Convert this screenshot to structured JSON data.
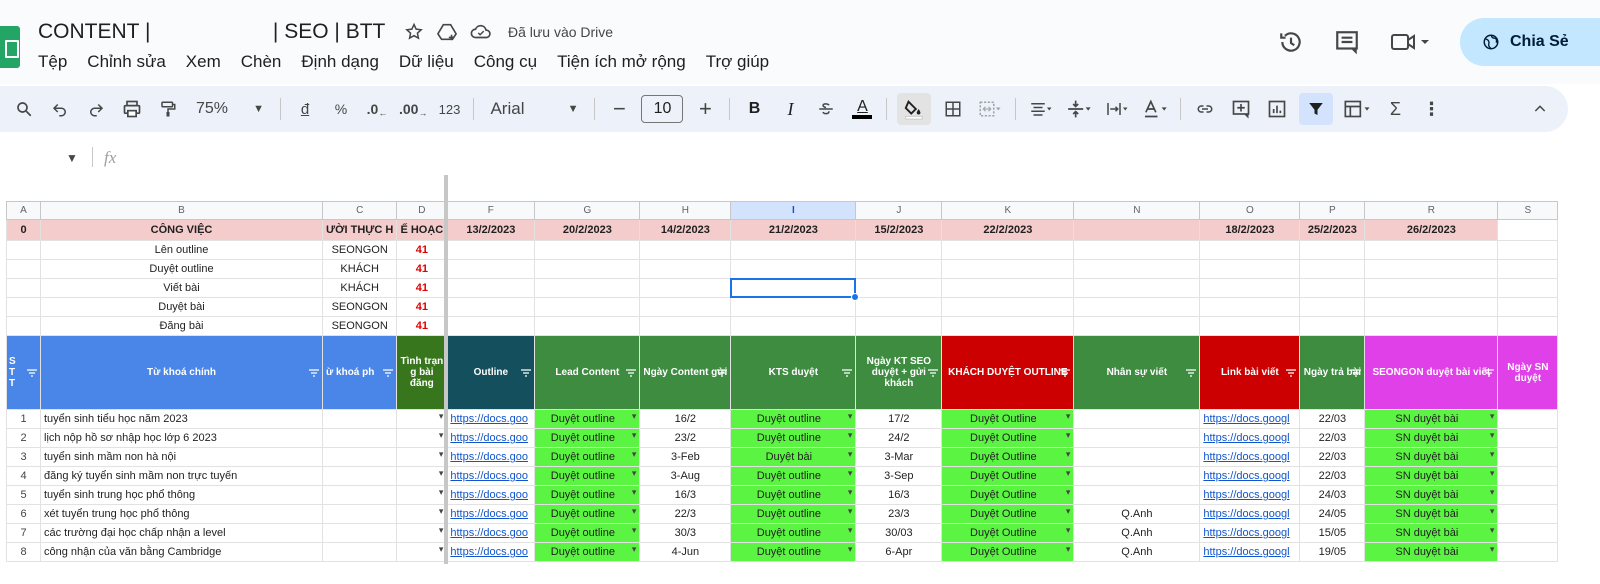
{
  "header": {
    "doc_title": "CONTENT |                     | SEO | BTT",
    "saved_status": "Đã lưu vào Drive",
    "share_label": "Chia Sẻ"
  },
  "menu": [
    "Tệp",
    "Chỉnh sửa",
    "Xem",
    "Chèn",
    "Định dạng",
    "Dữ liệu",
    "Công cụ",
    "Tiện ích mở rộng",
    "Trợ giúp"
  ],
  "toolbar": {
    "zoom": "75%",
    "currency": "đ",
    "percent": "%",
    "dec_decrease": ".0",
    "dec_increase": ".00",
    "number_format": "123",
    "font": "Arial",
    "font_size": "10",
    "bold": "B",
    "italic": "I",
    "text_color": "A"
  },
  "formula_bar": {
    "fx": "fx"
  },
  "columns": [
    "A",
    "B",
    "C",
    "D",
    "F",
    "G",
    "H",
    "I",
    "J",
    "K",
    "N",
    "O",
    "P",
    "R",
    "S"
  ],
  "summary_row": [
    "0",
    "CÔNG VIỆC",
    "ƯỜI THỰC H",
    "Ế HOẠC",
    "13/2/2023",
    "20/2/2023",
    "14/2/2023",
    "21/2/2023",
    "15/2/2023",
    "22/2/2023",
    "",
    "18/2/2023",
    "25/2/2023",
    "26/2/2023",
    ""
  ],
  "plan_rows": [
    {
      "task": "Lên outline",
      "owner": "SEONGON",
      "value": "41"
    },
    {
      "task": "Duyệt outline",
      "owner": "KHÁCH",
      "value": "41"
    },
    {
      "task": "Viết bài",
      "owner": "KHÁCH",
      "value": "41"
    },
    {
      "task": "Duyệt bài",
      "owner": "SEONGON",
      "value": "41"
    },
    {
      "task": "Đăng bài",
      "owner": "SEONGON",
      "value": "41"
    }
  ],
  "table_headers": {
    "stt": "S T T",
    "keyword": "Từ khoá chính",
    "sub_keyword": "ừ khoá ph",
    "status": "Tình trạn g bài đăng",
    "outline": "Outline",
    "lead": "Lead Content",
    "sent_date": "Ngày Content gửi",
    "kts": "KTS duyệt",
    "kt_date": "Ngày KT SEO duyệt + gửi khách",
    "client": "KHÁCH DUYỆT OUTLINE",
    "writer": "Nhân sự viết",
    "link": "Link bài viết",
    "return_date": "Ngày trả bài",
    "sn_approve": "SEONGON duyệt bài viết",
    "sn_date": "Ngày SN duyệt"
  },
  "rows": [
    {
      "n": "1",
      "kw": "tuyển sinh tiểu học năm 2023",
      "outline": "https://docs.goo",
      "lead": "Duyệt outline",
      "sent": "16/2",
      "kts": "Duyệt outline",
      "kt": "17/2",
      "client": "Duyệt Outline",
      "writer": "",
      "link": "https://docs.googl",
      "ret": "22/03",
      "sn": "SN duyệt bài"
    },
    {
      "n": "2",
      "kw": "lịch nộp hồ sơ nhập học lớp 6 2023",
      "outline": "https://docs.goo",
      "lead": "Duyệt outline",
      "sent": "23/2",
      "kts": "Duyệt outline",
      "kt": "24/2",
      "client": "Duyệt Outline",
      "writer": "",
      "link": "https://docs.googl",
      "ret": "22/03",
      "sn": "SN duyệt bài"
    },
    {
      "n": "3",
      "kw": "tuyển sinh mầm non hà nội",
      "outline": "https://docs.goo",
      "lead": "Duyệt outline",
      "sent": "3-Feb",
      "kts": "Duyệt bài",
      "kt": "3-Mar",
      "client": "Duyệt Outline",
      "writer": "",
      "link": "https://docs.googl",
      "ret": "22/03",
      "sn": "SN duyệt bài"
    },
    {
      "n": "4",
      "kw": "đăng ký tuyển sinh mầm non trực tuyến",
      "outline": "https://docs.goo",
      "lead": "Duyệt outline",
      "sent": "3-Aug",
      "kts": "Duyệt outline",
      "kt": "3-Sep",
      "client": "Duyệt Outline",
      "writer": "",
      "link": "https://docs.googl",
      "ret": "22/03",
      "sn": "SN duyệt bài"
    },
    {
      "n": "5",
      "kw": "tuyển sinh trung học phổ thông",
      "outline": "https://docs.goo",
      "lead": "Duyệt outline",
      "sent": "16/3",
      "kts": "Duyệt outline",
      "kt": "16/3",
      "client": "Duyệt Outline",
      "writer": "",
      "link": "https://docs.googl",
      "ret": "24/03",
      "sn": "SN duyệt bài"
    },
    {
      "n": "6",
      "kw": "xét tuyển trung học phổ thông",
      "outline": "https://docs.goo",
      "lead": "Duyệt outline",
      "sent": "22/3",
      "kts": "Duyệt outline",
      "kt": "23/3",
      "client": "Duyệt Outline",
      "writer": "Q.Anh",
      "link": "https://docs.googl",
      "ret": "24/05",
      "sn": "SN duyệt bài"
    },
    {
      "n": "7",
      "kw": "các trường đại học chấp nhận a level",
      "outline": "https://docs.goo",
      "lead": "Duyệt outline",
      "sent": "30/3",
      "kts": "Duyệt outline",
      "kt": "30/03",
      "client": "Duyệt Outline",
      "writer": "Q.Anh",
      "link": "https://docs.googl",
      "ret": "15/05",
      "sn": "SN duyệt bài"
    },
    {
      "n": "8",
      "kw": "công nhận của văn bằng Cambridge",
      "outline": "https://docs.goo",
      "lead": "Duyệt outline",
      "sent": "4-Jun",
      "kts": "Duyệt outline",
      "kt": "6-Apr",
      "client": "Duyệt Outline",
      "writer": "Q.Anh",
      "link": "https://docs.googl",
      "ret": "19/05",
      "sn": "SN duyệt bài"
    }
  ]
}
